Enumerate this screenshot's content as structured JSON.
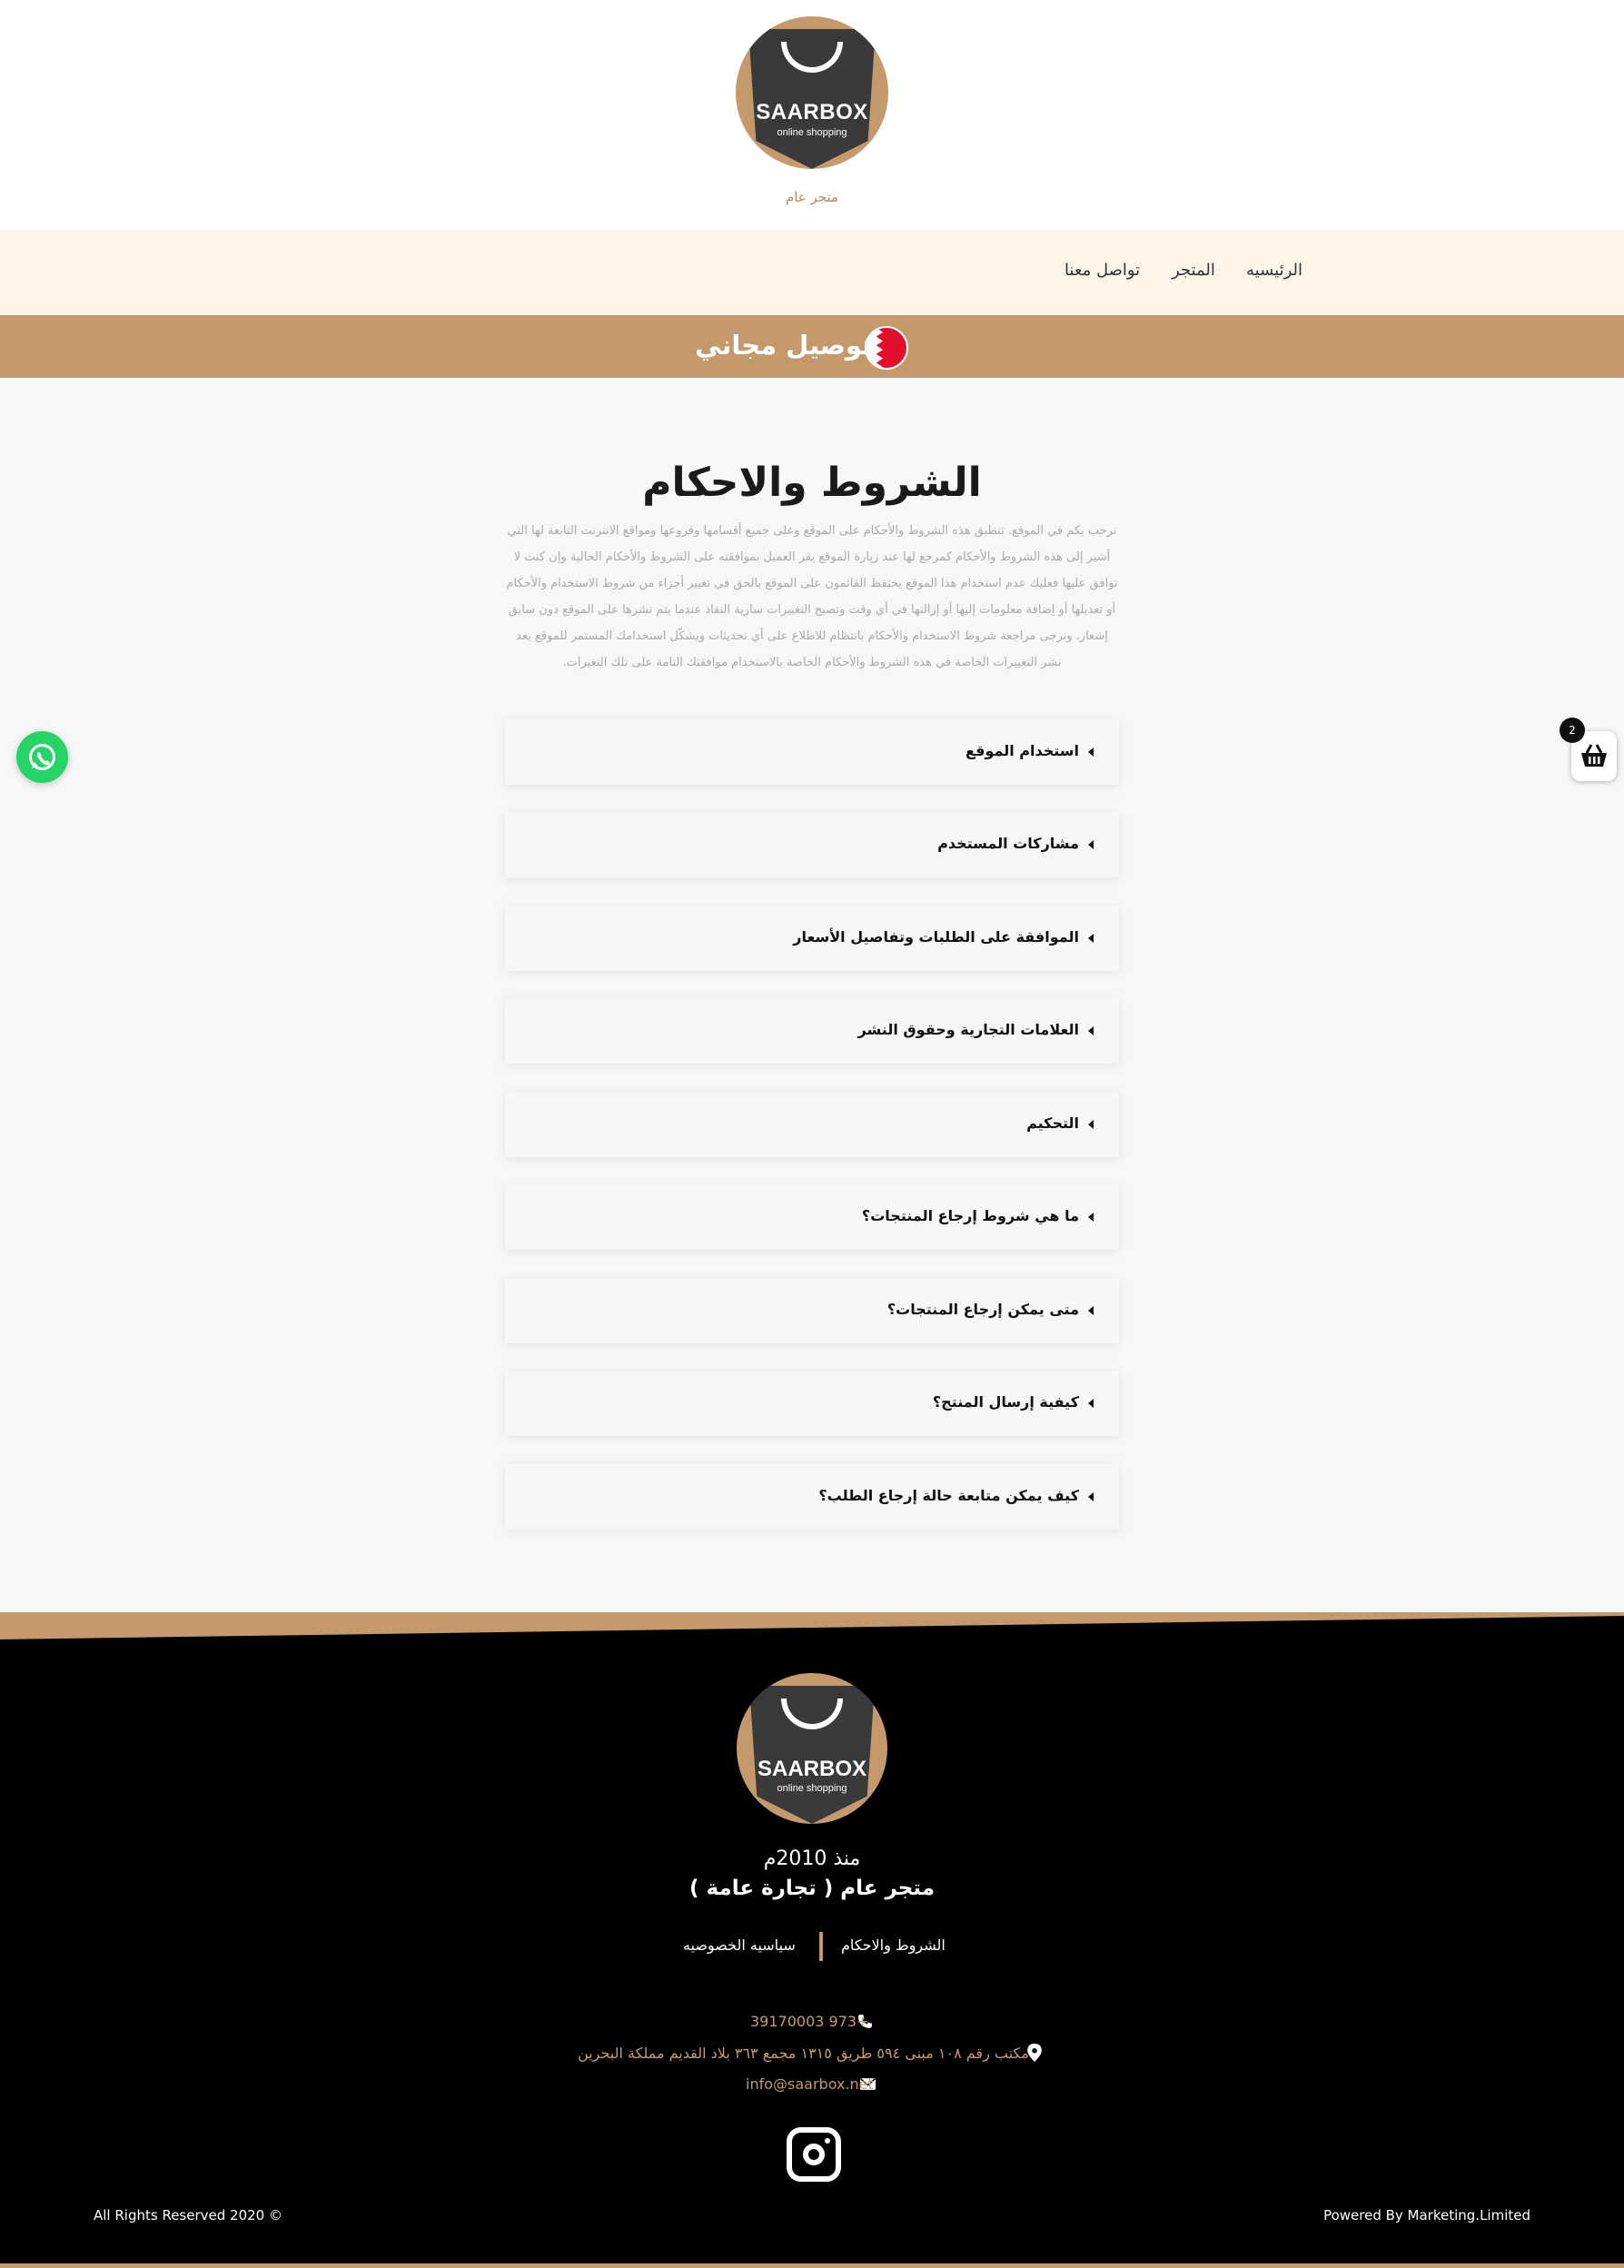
{
  "colors": {
    "accent": "#c49a6c",
    "nav_bg": "#fdf3e6",
    "footer_bg": "#000000",
    "whatsapp": "#25d366"
  },
  "logo": {
    "brand": "SAARBOX",
    "subtitle": "online shopping"
  },
  "header": {
    "tagline": "متجر عام"
  },
  "nav": {
    "home": "الرئيسيه",
    "store": "المتجر",
    "contact": "تواصل معنا"
  },
  "banner": {
    "text": "توصيل مجاني",
    "flag_icon": "bahrain-flag-icon"
  },
  "page": {
    "title": "الشروط والاحكام",
    "intro": "نرحب بكم في الموقع. تنطبق هذه الشروط والأحكام على الموقع وعلى جميع أقسامها وفروعها ومواقع الانترنت التابعة لها التي أشير إلى هذه الشروط والأحكام كمرجع لها عند زيارة الموقع يقر العميل بموافقته على الشروط والأحكام الحالية وإن كنت لا توافق عليها فعليك عدم استخدام هذا الموقع يحتفظ القائمون على الموقع بالحق في تغيير أجزاء من شروط الاستخدام والأحكام أو تعديلها أو إضافة معلومات إليها أو إزالتها في أي وقت وتصبح التغييرات سارية النفاذ عندما يتم نشرها على الموقع دون سابق إشعار. ونرجى مراجعة شروط الاستخدام والأحكام بانتظام للاطلاع على أي تحديثات ويشكّل استخدامك المستمر للموقع بعد نشر التغييرات الخاصة في هذه الشروط والأحكام الخاصة بالاستخدام موافقتك التامة على تلك التغيرات."
  },
  "accordion": [
    {
      "label": "استخدام الموقع"
    },
    {
      "label": "مشاركات المستخدم"
    },
    {
      "label": "الموافقة على الطلبات وتفاصيل الأسعار"
    },
    {
      "label": "العلامات التجارية وحقوق النشر"
    },
    {
      "label": "التحكيم"
    },
    {
      "label": "ما هي شروط إرجاع المنتجات؟"
    },
    {
      "label": "متى يمكن إرجاع المنتجات؟"
    },
    {
      "label": "كيفية إرسال المنتج؟"
    },
    {
      "label": "كيف يمكن متابعة حالة إرجاع الطلب؟"
    }
  ],
  "cart": {
    "count": "2"
  },
  "footer": {
    "since": "منذ 2010م",
    "store_name": "متجر عام ( تجارة عامة )",
    "links": {
      "terms": "الشروط والاحكام",
      "privacy": "سياسيه الخصوصيه"
    },
    "phone": "+973 39170003",
    "address": "مكتب رقم ١٠٨ مبنى ٥٩٤ طريق ١٣١٥ مجمع ٣٦٣ بلاد القديم مملكة البحرين",
    "email": "info@saarbox.net",
    "rights": "All Rights Reserved 2020 ©",
    "powered": "Powered By Marketing.Limited"
  }
}
